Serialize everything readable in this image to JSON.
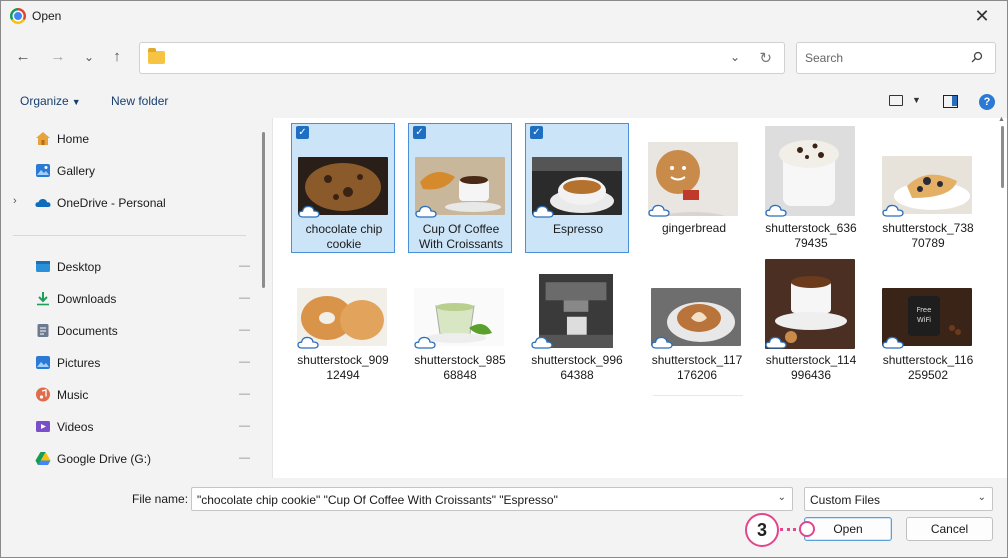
{
  "window": {
    "title": "Open",
    "close_glyph": "✕"
  },
  "nav": {
    "back": "←",
    "forward": "→",
    "recent": "⌄",
    "up": "↑",
    "address_chevron": "⌄",
    "refresh": "↻"
  },
  "search": {
    "placeholder": "Search"
  },
  "toolbar": {
    "organize_label": "Organize",
    "organize_caret": "▼",
    "new_folder_label": "New folder",
    "view_caret": "▼",
    "help_glyph": "?"
  },
  "sidebar": {
    "items": [
      {
        "label": "Home",
        "icon": "home-icon",
        "pinned": false
      },
      {
        "label": "Gallery",
        "icon": "gallery-icon",
        "pinned": false
      },
      {
        "label": "OneDrive - Personal",
        "icon": "onedrive-cloud-icon",
        "pinned": false,
        "expandable": true
      },
      {
        "label": "Desktop",
        "icon": "desktop-icon",
        "pinned": true
      },
      {
        "label": "Downloads",
        "icon": "downloads-icon",
        "pinned": true
      },
      {
        "label": "Documents",
        "icon": "documents-icon",
        "pinned": true
      },
      {
        "label": "Pictures",
        "icon": "pictures-icon",
        "pinned": true
      },
      {
        "label": "Music",
        "icon": "music-icon",
        "pinned": true
      },
      {
        "label": "Videos",
        "icon": "videos-icon",
        "pinned": true
      },
      {
        "label": "Google Drive (G:)",
        "icon": "google-drive-icon",
        "pinned": true
      }
    ],
    "expander_glyph": "›",
    "pin_glyph": "📌"
  },
  "files": [
    {
      "name_line1": "chocolate chip",
      "name_line2": "cookie",
      "selected": true
    },
    {
      "name_line1": "Cup Of Coffee",
      "name_line2": "With Croissants",
      "selected": true
    },
    {
      "name_line1": "Espresso",
      "name_line2": "",
      "selected": true
    },
    {
      "name_line1": "gingerbread",
      "name_line2": "",
      "selected": false
    },
    {
      "name_line1": "shutterstock_636",
      "name_line2": "79435",
      "selected": false
    },
    {
      "name_line1": "shutterstock_738",
      "name_line2": "70789",
      "selected": false
    },
    {
      "name_line1": "shutterstock_909",
      "name_line2": "12494",
      "selected": false
    },
    {
      "name_line1": "shutterstock_985",
      "name_line2": "68848",
      "selected": false
    },
    {
      "name_line1": "shutterstock_996",
      "name_line2": "64388",
      "selected": false
    },
    {
      "name_line1": "shutterstock_117",
      "name_line2": "176206",
      "selected": false
    },
    {
      "name_line1": "shutterstock_114",
      "name_line2": "996436",
      "selected": false
    },
    {
      "name_line1": "shutterstock_116",
      "name_line2": "259502",
      "selected": false
    }
  ],
  "file_name": {
    "label": "File name:",
    "value": "\"chocolate chip cookie\" \"Cup Of Coffee With Croissants\" \"Espresso\"",
    "dropdown_glyph": "⌄"
  },
  "file_type": {
    "value": "Custom Files",
    "dropdown_glyph": "⌄"
  },
  "buttons": {
    "open": "Open",
    "cancel": "Cancel"
  },
  "annotation": {
    "step": "3"
  },
  "colors": {
    "selection_bg": "#cce4f7",
    "selection_border": "#4a90d9",
    "accent": "#1e6fc2",
    "annotation": "#e2468e"
  }
}
